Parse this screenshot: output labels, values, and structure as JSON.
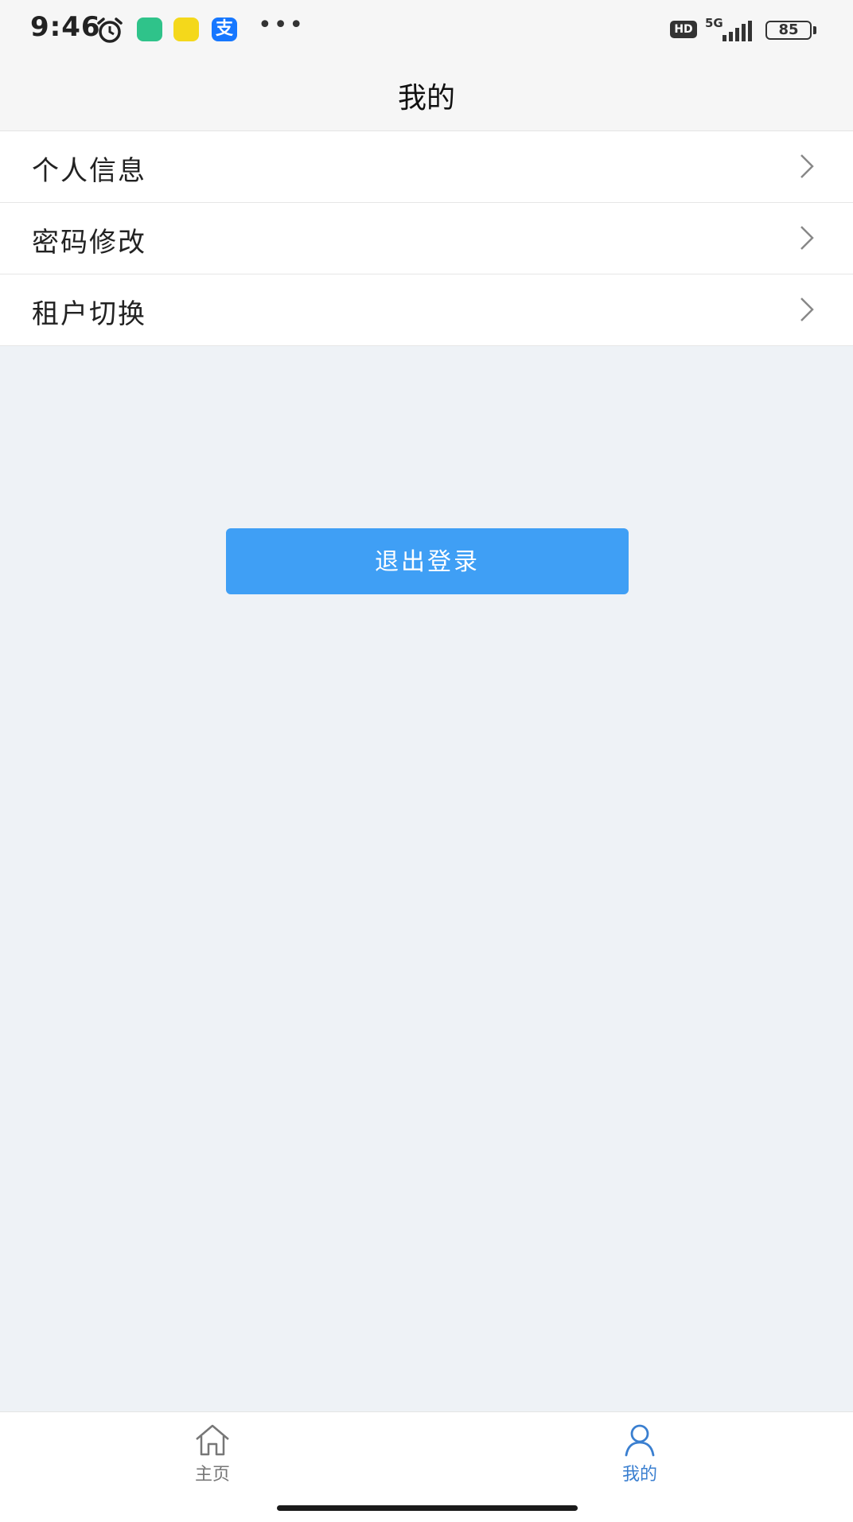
{
  "status_bar": {
    "time": "9:46",
    "hd_label": "HD",
    "network": "5G",
    "battery": "85",
    "icons": [
      "alarm-icon",
      "security-app-icon",
      "yellow-app-icon",
      "alipay-icon",
      "more-dots-icon",
      "signal-icon",
      "battery-icon"
    ]
  },
  "header": {
    "title": "我的"
  },
  "menu": {
    "items": [
      {
        "label": "个人信息",
        "icon": "chevron-right-icon"
      },
      {
        "label": "密码修改",
        "icon": "chevron-right-icon"
      },
      {
        "label": "租户切换",
        "icon": "chevron-right-icon"
      }
    ]
  },
  "logout": {
    "label": "退出登录"
  },
  "tabs": [
    {
      "label": "主页",
      "icon": "home-icon",
      "active": false
    },
    {
      "label": "我的",
      "icon": "user-icon",
      "active": true
    }
  ],
  "colors": {
    "primary_button": "#3f9ff5",
    "active_tab": "#3a7fd0",
    "page_background": "#eef2f6"
  }
}
